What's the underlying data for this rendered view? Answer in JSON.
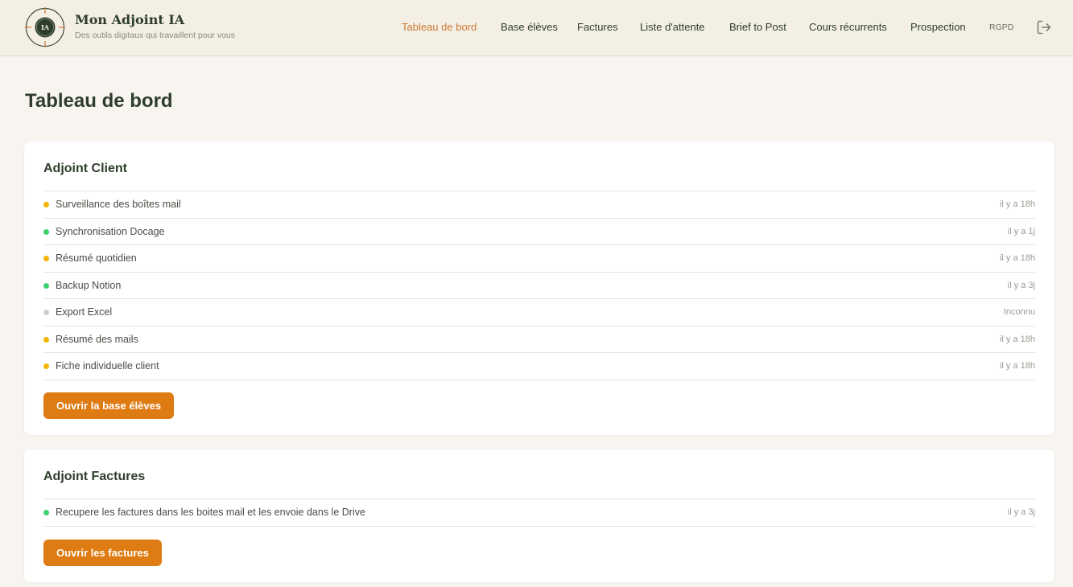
{
  "brand": {
    "logo_text": "IA",
    "title": "Mon Adjoint IA",
    "tagline": "Des outils digitaux qui travaillent pour vous"
  },
  "nav": {
    "items": [
      {
        "label": "Tableau de bord",
        "active": true
      },
      {
        "label": "Base élèves"
      },
      {
        "label": "Factures"
      },
      {
        "label": "Liste d'attente"
      },
      {
        "label": "Brief to Post"
      },
      {
        "label": "Cours récurrents"
      },
      {
        "label": "Prospection"
      },
      {
        "label": "RGPD"
      }
    ],
    "logout_icon": "logout-icon"
  },
  "page": {
    "title": "Tableau de bord"
  },
  "status_colors": {
    "warning": "#f4b400",
    "ok": "#3ecf6e",
    "unknown": "#cfcfcf"
  },
  "cards": [
    {
      "title": "Adjoint Client",
      "rows": [
        {
          "label": "Surveillance des boîtes mail",
          "time": "il y a 18h",
          "status": "warning"
        },
        {
          "label": "Synchronisation Docage",
          "time": "il y a 1j",
          "status": "ok"
        },
        {
          "label": "Résumé quotidien",
          "time": "il y a 18h",
          "status": "warning"
        },
        {
          "label": "Backup Notion",
          "time": "il y a 3j",
          "status": "ok"
        },
        {
          "label": "Export Excel",
          "time": "Inconnu",
          "status": "unknown"
        },
        {
          "label": "Résumé des mails",
          "time": "il y a 18h",
          "status": "warning"
        },
        {
          "label": "Fiche individuelle client",
          "time": "il y a 18h",
          "status": "warning"
        }
      ],
      "button": "Ouvrir la base élèves"
    },
    {
      "title": "Adjoint Factures",
      "rows": [
        {
          "label": "Recupere les factures dans les boites mail et les envoie dans le Drive",
          "time": "il y a 3j",
          "status": "ok"
        }
      ],
      "button": "Ouvrir les factures"
    }
  ]
}
